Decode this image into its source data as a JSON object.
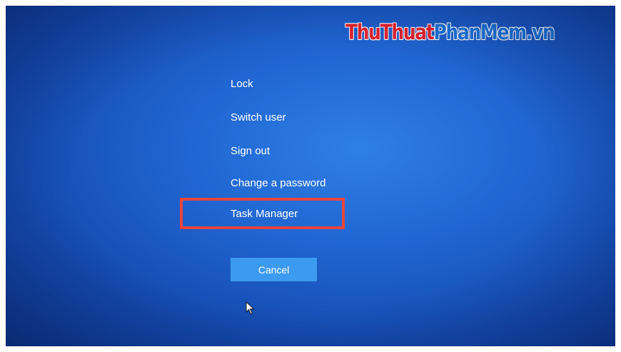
{
  "watermark": {
    "part1": "ThuThuat",
    "part2": "PhanMem.vn"
  },
  "menu": {
    "lock": "Lock",
    "switch_user": "Switch user",
    "sign_out": "Sign out",
    "change_password": "Change a password",
    "task_manager": "Task Manager"
  },
  "cancel_label": "Cancel",
  "colors": {
    "background": "#1f63cf",
    "cancel_button": "#3c9af0",
    "highlight": "#e8453d",
    "watermark_red": "#e0242e",
    "watermark_blue": "#1c73d6"
  },
  "icons": {
    "cursor": "mouse-pointer-icon"
  }
}
